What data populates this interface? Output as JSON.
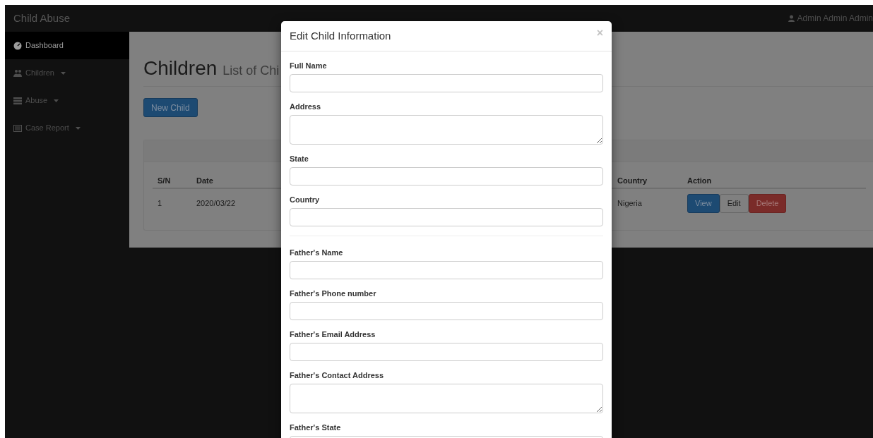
{
  "navbar": {
    "brand": "Child Abuse",
    "user": "Admin Admin Admin"
  },
  "sidebar": {
    "items": [
      {
        "label": "Dashboard",
        "selected": true,
        "has_caret": false
      },
      {
        "label": "Children",
        "selected": false,
        "has_caret": true
      },
      {
        "label": "Abuse",
        "selected": false,
        "has_caret": true
      },
      {
        "label": "Case Report",
        "selected": false,
        "has_caret": true
      }
    ]
  },
  "page": {
    "title": "Children",
    "subtitle": "List of Chi",
    "new_button": "New Child"
  },
  "table": {
    "columns": [
      "S/N",
      "Date",
      "Country",
      "Action"
    ],
    "rows": [
      {
        "cells": [
          "1",
          "2020/03/22",
          "Nigeria"
        ],
        "actions": [
          {
            "label": "View",
            "kind": "primary"
          },
          {
            "label": "Edit",
            "kind": "default"
          },
          {
            "label": "Delete",
            "kind": "danger"
          }
        ]
      }
    ]
  },
  "modal": {
    "title": "Edit Child Information",
    "close": "×",
    "sections": [
      {
        "fields": [
          {
            "label": "Full Name",
            "kind": "input"
          },
          {
            "label": "Address",
            "kind": "textarea"
          },
          {
            "label": "State",
            "kind": "input"
          },
          {
            "label": "Country",
            "kind": "input"
          }
        ]
      },
      {
        "fields": [
          {
            "label": "Father's Name",
            "kind": "input"
          },
          {
            "label": "Father's Phone number",
            "kind": "input"
          },
          {
            "label": "Father's Email Address",
            "kind": "input"
          },
          {
            "label": "Father's Contact Address",
            "kind": "textarea"
          },
          {
            "label": "Father's State",
            "kind": "input"
          }
        ]
      }
    ]
  }
}
